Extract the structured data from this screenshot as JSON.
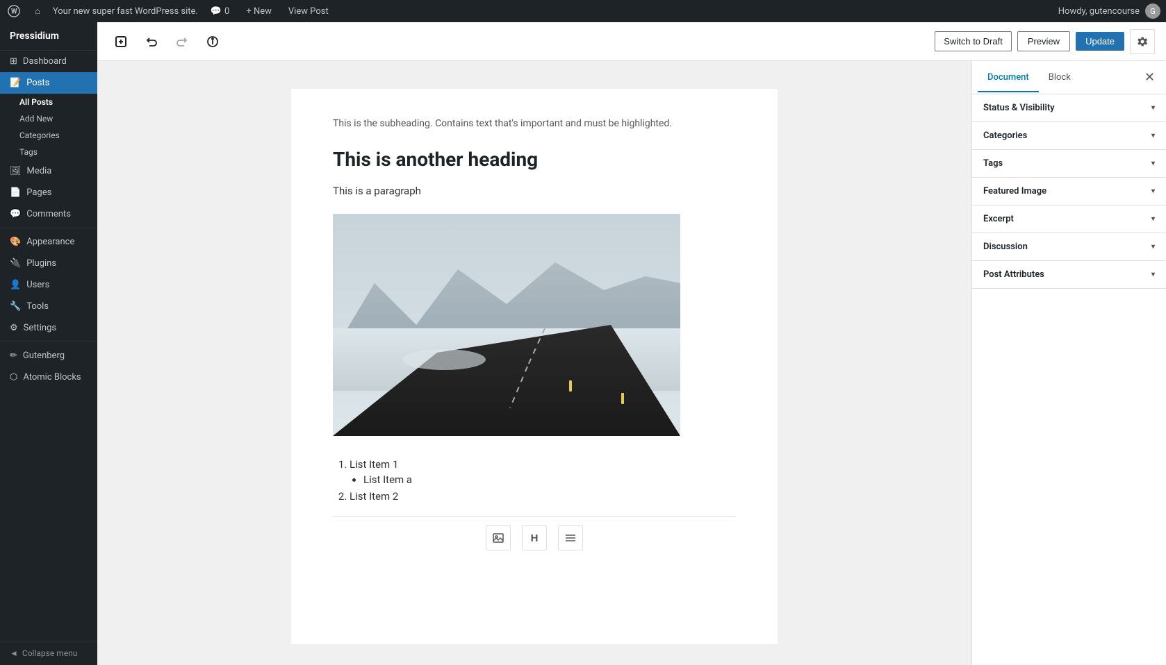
{
  "adminbar": {
    "wp_logo": "W",
    "site_name": "Your new super fast WordPress site.",
    "comments_count": "0",
    "new_label": "+ New",
    "view_post_label": "View Post",
    "howdy": "Howdy, gutencourse",
    "avatar_initials": "G"
  },
  "sidebar": {
    "brand": "Pressidium",
    "items": [
      {
        "id": "dashboard",
        "label": "Dashboard",
        "icon": "⊞"
      },
      {
        "id": "posts",
        "label": "Posts",
        "icon": "📝",
        "active": true
      },
      {
        "id": "media",
        "label": "Media",
        "icon": "🖼"
      },
      {
        "id": "pages",
        "label": "Pages",
        "icon": "📄"
      },
      {
        "id": "comments",
        "label": "Comments",
        "icon": "💬"
      },
      {
        "id": "appearance",
        "label": "Appearance",
        "icon": "🎨"
      },
      {
        "id": "plugins",
        "label": "Plugins",
        "icon": "🔌"
      },
      {
        "id": "users",
        "label": "Users",
        "icon": "👤"
      },
      {
        "id": "tools",
        "label": "Tools",
        "icon": "🔧"
      },
      {
        "id": "settings",
        "label": "Settings",
        "icon": "⚙"
      },
      {
        "id": "gutenberg",
        "label": "Gutenberg",
        "icon": "✏"
      },
      {
        "id": "atomic-blocks",
        "label": "Atomic Blocks",
        "icon": "⬡"
      }
    ],
    "posts_subitems": [
      {
        "label": "All Posts",
        "active": true
      },
      {
        "label": "Add New"
      },
      {
        "label": "Categories"
      },
      {
        "label": "Tags"
      }
    ],
    "collapse_label": "Collapse menu"
  },
  "toolbar": {
    "add_block_title": "Add Block",
    "undo_title": "Undo",
    "redo_title": "Redo",
    "info_title": "Content Structure",
    "switch_draft_label": "Switch to Draft",
    "preview_label": "Preview",
    "update_label": "Update",
    "settings_title": "Settings"
  },
  "post": {
    "subheading": "This is the subheading. Contains text that's important and must be highlighted.",
    "heading2": "This is another heading",
    "paragraph": "This is a paragraph",
    "list_items": [
      {
        "text": "List Item 1",
        "children": [
          "List Item a"
        ]
      },
      {
        "text": "List Item 2",
        "children": []
      }
    ]
  },
  "right_panel": {
    "tabs": [
      {
        "label": "Document",
        "active": true
      },
      {
        "label": "Block"
      }
    ],
    "close_icon": "✕",
    "sections": [
      {
        "label": "Status & Visibility",
        "id": "status-visibility"
      },
      {
        "label": "Categories",
        "id": "categories"
      },
      {
        "label": "Tags",
        "id": "tags"
      },
      {
        "label": "Featured Image",
        "id": "featured-image"
      },
      {
        "label": "Excerpt",
        "id": "excerpt"
      },
      {
        "label": "Discussion",
        "id": "discussion"
      },
      {
        "label": "Post Attributes",
        "id": "post-attributes"
      }
    ]
  },
  "icons": {
    "add_block": "+",
    "undo": "↩",
    "redo": "↪",
    "info": "ⓘ",
    "gear": "⚙",
    "image_block": "🖼",
    "heading_block": "H",
    "list_block": "☰",
    "chevron_down": "▾",
    "wp_logo": "W",
    "house_icon": "⌂",
    "comment_bubble": "💬",
    "collapse_icon": "◄"
  },
  "colors": {
    "admin_bar_bg": "#1d2327",
    "sidebar_bg": "#1d2327",
    "active_menu_item": "#2271b1",
    "update_btn": "#2271b1",
    "doc_tab_active": "#007cba"
  }
}
